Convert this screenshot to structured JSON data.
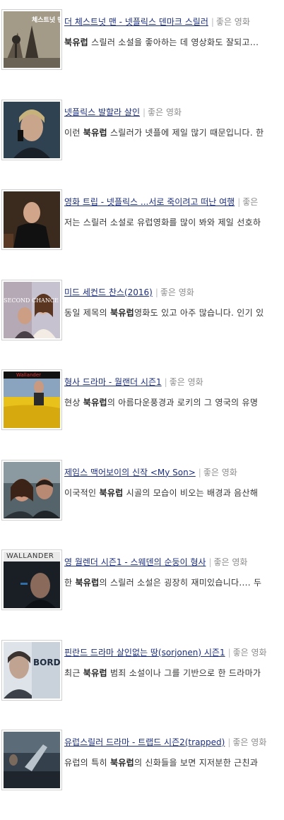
{
  "posts": [
    {
      "title": "더 체스트넛 맨 - 넷플릭스 덴마크 스릴러",
      "category": "좋은 영화",
      "thumb_text": "체스트넛 맨",
      "snippet_pre": "",
      "snippet_bold": "북유럽",
      "snippet_post": " 스릴러 소설을 좋아하는 데 영상화도 잘되고..."
    },
    {
      "title": "넷플릭스 발할라 살인",
      "category": "좋은 영화",
      "thumb_text": "",
      "snippet_pre": "이런 ",
      "snippet_bold": "북유럽",
      "snippet_post": " 스릴러가 넷플에 제일 많기 때문입니다. 한"
    },
    {
      "title": "영화 트립 - 넷플릭스 ...서로 죽이려고 떠난 여행",
      "category": "좋은",
      "thumb_text": "",
      "snippet_pre": "저는 스릴러 소설로 유럽영화를 많이 봐와 제일 선호하",
      "snippet_bold": "",
      "snippet_post": ""
    },
    {
      "title": "미드 세컨드 찬스(2016)",
      "category": "좋은 영화",
      "thumb_text": "SECOND CHANCE",
      "snippet_pre": "동일 제목의 ",
      "snippet_bold": "북유럽",
      "snippet_post": "영화도 있고 아주 많습니다. 인기 있"
    },
    {
      "title": "형사 드라마 - 월랜더 시즌1",
      "category": "좋은 영화",
      "thumb_text": "Wallander",
      "snippet_pre": "현상 ",
      "snippet_bold": "북유럽",
      "snippet_post": "의 아름다운풍경과 로키의 그 영국의 유명"
    },
    {
      "title": "제임스 맥어보이의 신작 <My Son>",
      "category": "좋은 영화",
      "thumb_text": "",
      "snippet_pre": "이국적인 ",
      "snippet_bold": "북유럽",
      "snippet_post": " 시골의 모습이 비오는 배경과 음산해"
    },
    {
      "title": "영 월렌더 시즌1 - 스웨덴의 순둥이 형사",
      "category": "좋은 영화",
      "thumb_text": "WALLANDER",
      "snippet_pre": "한 ",
      "snippet_bold": "북유럽",
      "snippet_post": "의 스릴러 소설은 굉장히 재미있습니다.... 두"
    },
    {
      "title": "핀란드 드라마 살인없는 땅(sorjonen) 시즌1",
      "category": "좋은 영화",
      "thumb_text": "BORD TOV",
      "snippet_pre": "최근 ",
      "snippet_bold": "북유럽",
      "snippet_post": " 범죄 소설이나 그를 기반으로 한 드라마가"
    },
    {
      "title": "유럽스릴러 드라마 - 트랩드 시즌2(trapped)",
      "category": "좋은 영화",
      "thumb_text": "",
      "snippet_pre": "유럽의 특히 ",
      "snippet_bold": "북유럽",
      "snippet_post": "의 신화들을 보면 지저분한 근친과"
    }
  ]
}
